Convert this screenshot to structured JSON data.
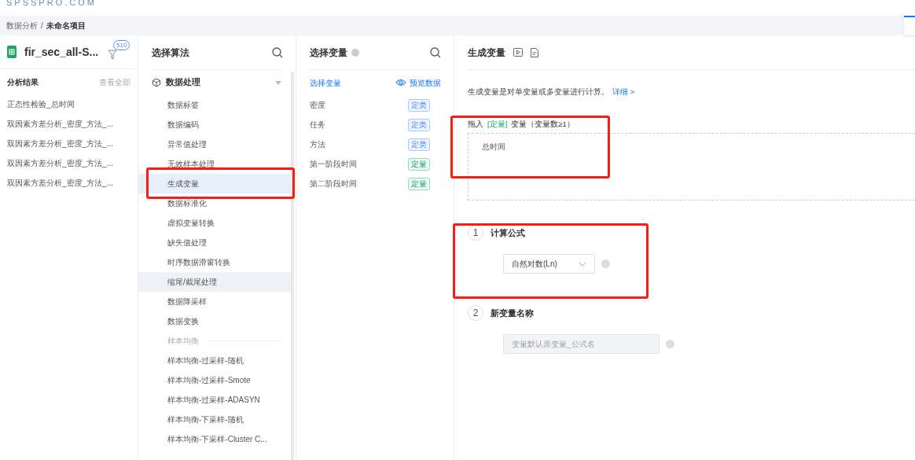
{
  "logo": "SPSSPRO.COM",
  "breadcrumb": {
    "parent": "数据分析",
    "separator": "/",
    "current": "未命名项目"
  },
  "file_panel": {
    "file_name": "fir_sec_all-S...",
    "filter_count": "510",
    "results_title": "分析结果",
    "view_all": "查看全部",
    "results": [
      "正态性检验_总时间",
      "双因素方差分析_密度_方法_...",
      "双因素方差分析_密度_方法_...",
      "双因素方差分析_密度_方法_...",
      "双因素方差分析_密度_方法_..."
    ]
  },
  "algorithm_panel": {
    "title": "选择算法",
    "group": {
      "label": "数据处理",
      "expanded": true
    },
    "items": [
      {
        "kind": "item",
        "label": "数据标签",
        "selected": false,
        "hovered": false
      },
      {
        "kind": "item",
        "label": "数据编码",
        "selected": false,
        "hovered": false
      },
      {
        "kind": "item",
        "label": "异常值处理",
        "selected": false,
        "hovered": false
      },
      {
        "kind": "item",
        "label": "无效样本处理",
        "selected": false,
        "hovered": false
      },
      {
        "kind": "item",
        "label": "生成变量",
        "selected": true,
        "hovered": false
      },
      {
        "kind": "item",
        "label": "数据标准化",
        "selected": false,
        "hovered": false
      },
      {
        "kind": "item",
        "label": "虚拟变量转换",
        "selected": false,
        "hovered": false
      },
      {
        "kind": "item",
        "label": "缺失值处理",
        "selected": false,
        "hovered": false
      },
      {
        "kind": "item",
        "label": "时序数据滑窗转换",
        "selected": false,
        "hovered": false
      },
      {
        "kind": "item",
        "label": "缩尾/截尾处理",
        "selected": false,
        "hovered": true
      },
      {
        "kind": "item",
        "label": "数据降采样",
        "selected": false,
        "hovered": false
      },
      {
        "kind": "item",
        "label": "数据变换",
        "selected": false,
        "hovered": false
      },
      {
        "kind": "section",
        "label": "样本均衡"
      },
      {
        "kind": "item",
        "label": "样本均衡-过采样-随机",
        "selected": false,
        "hovered": false
      },
      {
        "kind": "item",
        "label": "样本均衡-过采样-Smote",
        "selected": false,
        "hovered": false
      },
      {
        "kind": "item",
        "label": "样本均衡-过采样-ADASYN",
        "selected": false,
        "hovered": false
      },
      {
        "kind": "item",
        "label": "样本均衡-下采样-随机",
        "selected": false,
        "hovered": false
      },
      {
        "kind": "item",
        "label": "样本均衡-下采样-Cluster C...",
        "selected": false,
        "hovered": false
      }
    ]
  },
  "variable_panel": {
    "title": "选择变量",
    "subtitle": "选择变量",
    "preview": "预览数据",
    "variables": [
      {
        "name": "密度",
        "tag": "定类",
        "kind": "categorical"
      },
      {
        "name": "任务",
        "tag": "定类",
        "kind": "categorical"
      },
      {
        "name": "方法",
        "tag": "定类",
        "kind": "categorical"
      },
      {
        "name": "第一阶段时间",
        "tag": "定量",
        "kind": "quantitative"
      },
      {
        "name": "第二阶段时间",
        "tag": "定量",
        "kind": "quantitative"
      }
    ]
  },
  "config_panel": {
    "title": "生成变量",
    "description": "生成变量是对单变量或多变量进行计算。",
    "detail_link": "详细 >",
    "drop_label": {
      "prefix": "拖入",
      "tag": "[定量]",
      "suffix": "变量（变量数≥1）"
    },
    "dropped": [
      "总时间"
    ],
    "steps": [
      {
        "number": "1",
        "title": "计算公式",
        "kind": "select",
        "value": "自然对数(Ln)"
      },
      {
        "number": "2",
        "title": "新变量名称",
        "kind": "input",
        "placeholder": "变量默认原变量_公式名",
        "disabled": true
      }
    ]
  }
}
